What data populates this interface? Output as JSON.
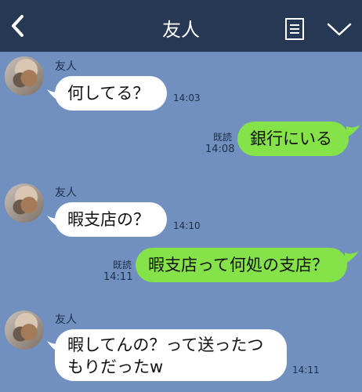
{
  "header": {
    "title": "友人"
  },
  "messages": [
    {
      "sender": "友人",
      "text": "何してる？",
      "time": "14:03"
    },
    {
      "read": "既読",
      "text": "銀行にいる",
      "time": "14:08"
    },
    {
      "sender": "友人",
      "text": "暇支店の？",
      "time": "14:10"
    },
    {
      "read": "既読",
      "text": "暇支店って何処の支店？",
      "time": "14:11"
    },
    {
      "sender": "友人",
      "line1": "暇してんの？って送ったつ",
      "line2": "もりだったw",
      "time": "14:11"
    }
  ],
  "colors": {
    "header": "#263853",
    "background": "#7190bf",
    "outgoing": "#85e249",
    "incoming": "#ffffff"
  },
  "icons": {
    "back": "chevron-left-icon",
    "menu": "list-icon",
    "more": "chevron-down-icon"
  }
}
